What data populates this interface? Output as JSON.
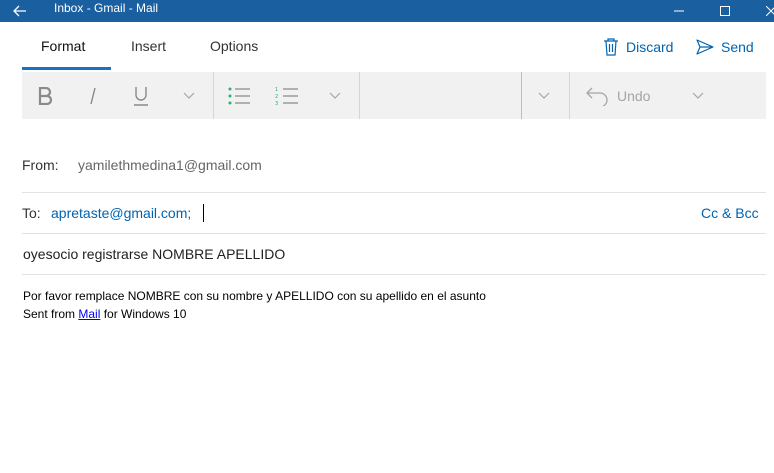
{
  "window": {
    "title": "Inbox - Gmail - Mail"
  },
  "ribbon": {
    "tabs": [
      {
        "label": "Format",
        "active": true
      },
      {
        "label": "Insert",
        "active": false
      },
      {
        "label": "Options",
        "active": false
      }
    ],
    "discard_label": "Discard",
    "send_label": "Send",
    "accent_color": "#0063b1"
  },
  "toolbar": {
    "undo_label": "Undo"
  },
  "header": {
    "from_label": "From:",
    "from_value": "yamilethmedina1@gmail.com",
    "to_label": "To:",
    "to_recipient": "apretaste@gmail.com;",
    "cc_bcc_label": "Cc & Bcc",
    "subject": "oyesocio registrarse NOMBRE APELLIDO"
  },
  "body": {
    "line1": "Por favor remplace NOMBRE con su nombre y APELLIDO con su apellido en el asunto",
    "signature_prefix": "Sent from ",
    "signature_link": "Mail",
    "signature_suffix": " for Windows 10"
  }
}
